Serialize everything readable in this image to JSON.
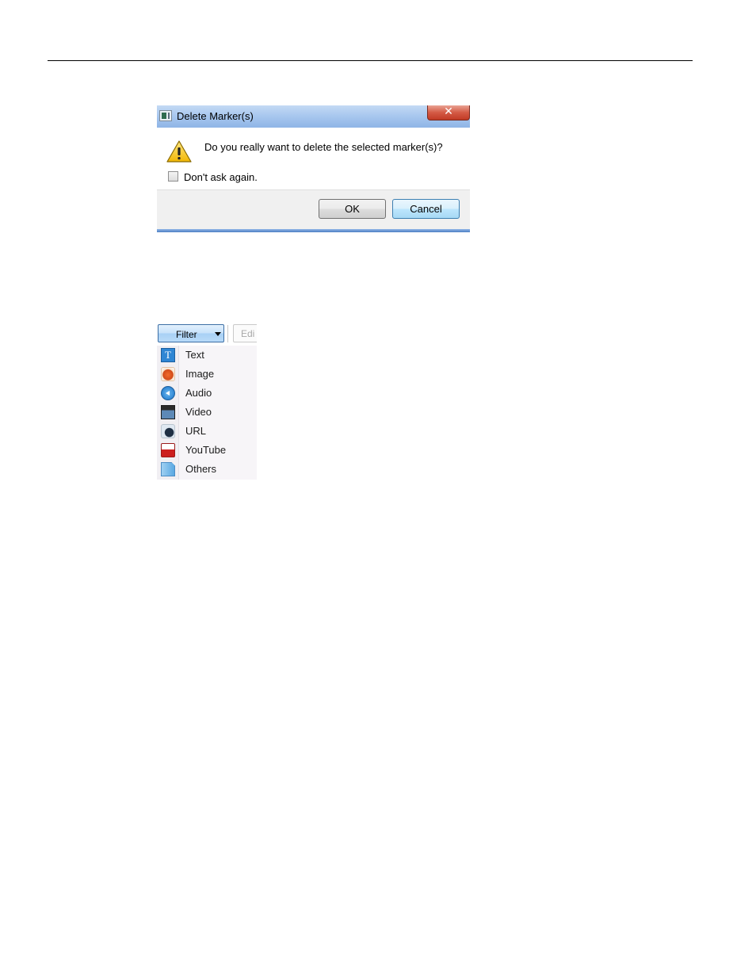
{
  "dialog": {
    "title": "Delete Marker(s)",
    "close_glyph": "✕",
    "message": "Do you really want to delete the selected marker(s)?",
    "checkbox_label": "Don't ask again.",
    "checkbox_checked": false,
    "ok_label": "OK",
    "cancel_label": "Cancel",
    "icons": {
      "app": "app-window-icon",
      "warning": "warning-icon"
    }
  },
  "filter": {
    "button_label": "Filter",
    "edit_label_partial": "Edi",
    "items": [
      {
        "label": "Text",
        "icon": "text-icon"
      },
      {
        "label": "Image",
        "icon": "image-icon"
      },
      {
        "label": "Audio",
        "icon": "audio-icon"
      },
      {
        "label": "Video",
        "icon": "video-icon"
      },
      {
        "label": "URL",
        "icon": "url-icon"
      },
      {
        "label": "YouTube",
        "icon": "youtube-icon"
      },
      {
        "label": "Others",
        "icon": "others-icon"
      }
    ]
  },
  "colors": {
    "titlebar": "#a9c8ef",
    "close_button": "#d45a45",
    "cancel_button": "#bee6fd",
    "menu_background": "#f7f5f8"
  }
}
